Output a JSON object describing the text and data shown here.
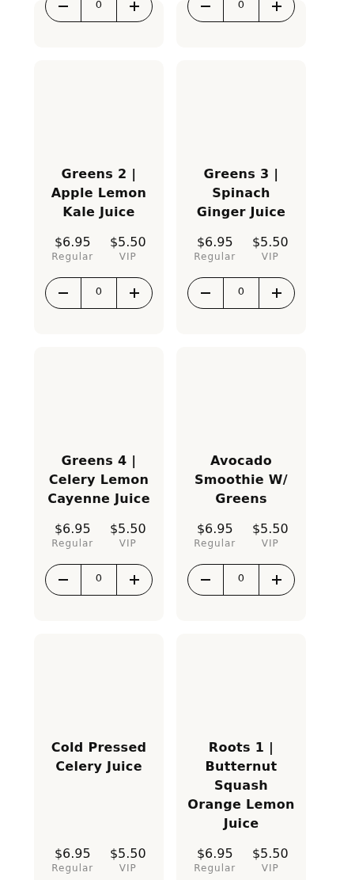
{
  "products": [
    {
      "quantity": "0"
    },
    {
      "quantity": "0"
    },
    {
      "name": "Greens 2 | Apple Lemon Kale Juice",
      "regular_price": "$6.95",
      "regular_label": "Regular",
      "vip_price": "$5.50",
      "vip_label": "VIP",
      "quantity": "0"
    },
    {
      "name": "Greens 3 | Spinach Ginger Juice",
      "regular_price": "$6.95",
      "regular_label": "Regular",
      "vip_price": "$5.50",
      "vip_label": "VIP",
      "quantity": "0"
    },
    {
      "name": "Greens 4 | Celery Lemon Cayenne Juice",
      "regular_price": "$6.95",
      "regular_label": "Regular",
      "vip_price": "$5.50",
      "vip_label": "VIP",
      "quantity": "0"
    },
    {
      "name": "Avocado Smoothie W/ Greens",
      "regular_price": "$6.95",
      "regular_label": "Regular",
      "vip_price": "$5.50",
      "vip_label": "VIP",
      "quantity": "0"
    },
    {
      "name": "Cold Pressed Celery Juice",
      "regular_price": "$6.95",
      "regular_label": "Regular",
      "vip_price": "$5.50",
      "vip_label": "VIP"
    },
    {
      "name": "Roots 1 | Butternut Squash Orange Lemon Juice",
      "regular_price": "$6.95",
      "regular_label": "Regular",
      "vip_price": "$5.50",
      "vip_label": "VIP"
    }
  ]
}
